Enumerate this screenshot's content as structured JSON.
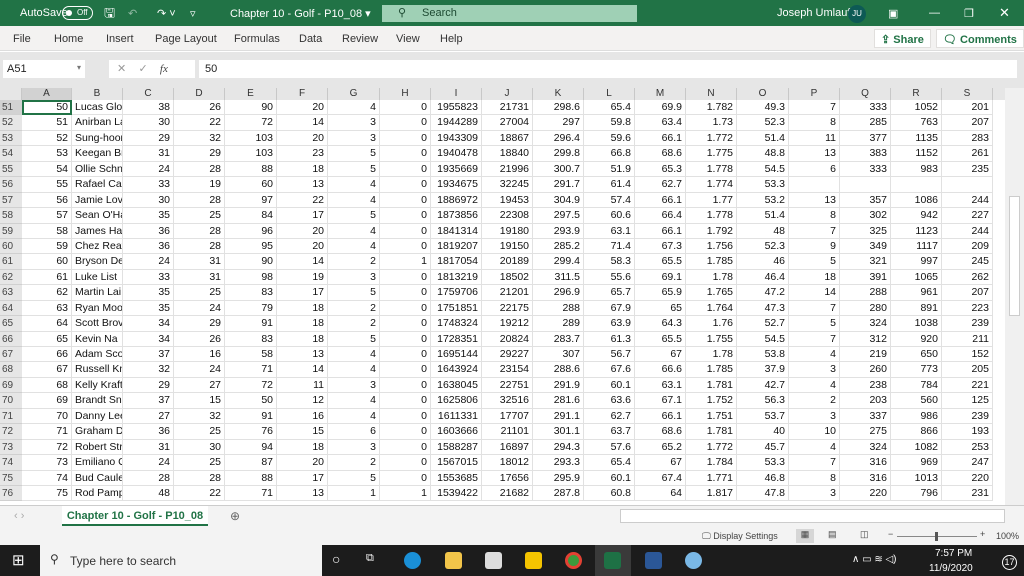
{
  "titlebar": {
    "autosave": "AutoSave",
    "autosave_state": "Off",
    "doc_title": "Chapter 10 - Golf - P10_08 ▾",
    "search": "Search",
    "user": "Joseph Umlauf",
    "initials": "JU"
  },
  "menu": [
    "File",
    "Home",
    "Insert",
    "Page Layout",
    "Formulas",
    "Data",
    "Review",
    "View",
    "Help"
  ],
  "share": "Share",
  "comments": "Comments",
  "formula_bar": {
    "name_box": "A51",
    "fx": "fx",
    "value": "50"
  },
  "columns": [
    "A",
    "B",
    "C",
    "D",
    "E",
    "F",
    "G",
    "H",
    "I",
    "J",
    "K",
    "L",
    "M",
    "N",
    "O",
    "P",
    "Q",
    "R",
    "S"
  ],
  "rows": [
    {
      "n": "51",
      "c": [
        "50",
        "Lucas Glov",
        "38",
        "26",
        "90",
        "20",
        "4",
        "0",
        "1955823",
        "21731",
        "298.6",
        "65.4",
        "69.9",
        "1.782",
        "49.3",
        "7",
        "333",
        "1052",
        "201"
      ]
    },
    {
      "n": "52",
      "c": [
        "51",
        "Anirban La",
        "30",
        "22",
        "72",
        "14",
        "3",
        "0",
        "1944289",
        "27004",
        "297",
        "59.8",
        "63.4",
        "1.73",
        "52.3",
        "8",
        "285",
        "763",
        "207"
      ]
    },
    {
      "n": "53",
      "c": [
        "52",
        "Sung-hoon",
        "29",
        "32",
        "103",
        "20",
        "3",
        "0",
        "1943309",
        "18867",
        "296.4",
        "59.6",
        "66.1",
        "1.772",
        "51.4",
        "11",
        "377",
        "1135",
        "283"
      ]
    },
    {
      "n": "54",
      "c": [
        "53",
        "Keegan Br",
        "31",
        "29",
        "103",
        "23",
        "5",
        "0",
        "1940478",
        "18840",
        "299.8",
        "66.8",
        "68.6",
        "1.775",
        "48.8",
        "13",
        "383",
        "1152",
        "261"
      ]
    },
    {
      "n": "55",
      "c": [
        "54",
        "Ollie Schni",
        "24",
        "28",
        "88",
        "18",
        "5",
        "0",
        "1935669",
        "21996",
        "300.7",
        "51.9",
        "65.3",
        "1.778",
        "54.5",
        "6",
        "333",
        "983",
        "235"
      ]
    },
    {
      "n": "56",
      "c": [
        "55",
        "Rafael Cab",
        "33",
        "19",
        "60",
        "13",
        "4",
        "0",
        "1934675",
        "32245",
        "291.7",
        "61.4",
        "62.7",
        "1.774",
        "53.3",
        "",
        "",
        "",
        ""
      ]
    },
    {
      "n": "57",
      "c": [
        "56",
        "Jamie Love",
        "30",
        "28",
        "97",
        "22",
        "4",
        "0",
        "1886972",
        "19453",
        "304.9",
        "57.4",
        "66.1",
        "1.77",
        "53.2",
        "13",
        "357",
        "1086",
        "244"
      ]
    },
    {
      "n": "58",
      "c": [
        "57",
        "Sean O'Ha",
        "35",
        "25",
        "84",
        "17",
        "5",
        "0",
        "1873856",
        "22308",
        "297.5",
        "60.6",
        "66.4",
        "1.778",
        "51.4",
        "8",
        "302",
        "942",
        "227"
      ]
    },
    {
      "n": "59",
      "c": [
        "58",
        "James Hah",
        "36",
        "28",
        "96",
        "20",
        "4",
        "0",
        "1841314",
        "19180",
        "293.9",
        "63.1",
        "66.1",
        "1.792",
        "48",
        "7",
        "325",
        "1123",
        "244"
      ]
    },
    {
      "n": "60",
      "c": [
        "59",
        "Chez Reav",
        "36",
        "28",
        "95",
        "20",
        "4",
        "0",
        "1819207",
        "19150",
        "285.2",
        "71.4",
        "67.3",
        "1.756",
        "52.3",
        "9",
        "349",
        "1117",
        "209"
      ]
    },
    {
      "n": "61",
      "c": [
        "60",
        "Bryson De",
        "24",
        "31",
        "90",
        "14",
        "2",
        "1",
        "1817054",
        "20189",
        "299.4",
        "58.3",
        "65.5",
        "1.785",
        "46",
        "5",
        "321",
        "997",
        "245"
      ]
    },
    {
      "n": "62",
      "c": [
        "61",
        "Luke List",
        "33",
        "31",
        "98",
        "19",
        "3",
        "0",
        "1813219",
        "18502",
        "311.5",
        "55.6",
        "69.1",
        "1.78",
        "46.4",
        "18",
        "391",
        "1065",
        "262"
      ]
    },
    {
      "n": "63",
      "c": [
        "62",
        "Martin Lai",
        "35",
        "25",
        "83",
        "17",
        "5",
        "0",
        "1759706",
        "21201",
        "296.9",
        "65.7",
        "65.9",
        "1.765",
        "47.2",
        "14",
        "288",
        "961",
        "207"
      ]
    },
    {
      "n": "64",
      "c": [
        "63",
        "Ryan Moo",
        "35",
        "24",
        "79",
        "18",
        "2",
        "0",
        "1751851",
        "22175",
        "288",
        "67.9",
        "65",
        "1.764",
        "47.3",
        "7",
        "280",
        "891",
        "223"
      ]
    },
    {
      "n": "65",
      "c": [
        "64",
        "Scott Brov",
        "34",
        "29",
        "91",
        "18",
        "2",
        "0",
        "1748324",
        "19212",
        "289",
        "63.9",
        "64.3",
        "1.76",
        "52.7",
        "5",
        "324",
        "1038",
        "239"
      ]
    },
    {
      "n": "66",
      "c": [
        "65",
        "Kevin Na",
        "34",
        "26",
        "83",
        "18",
        "5",
        "0",
        "1728351",
        "20824",
        "283.7",
        "61.3",
        "65.5",
        "1.755",
        "54.5",
        "7",
        "312",
        "920",
        "211"
      ]
    },
    {
      "n": "67",
      "c": [
        "66",
        "Adam Sco",
        "37",
        "16",
        "58",
        "13",
        "4",
        "0",
        "1695144",
        "29227",
        "307",
        "56.7",
        "67",
        "1.78",
        "53.8",
        "4",
        "219",
        "650",
        "152"
      ]
    },
    {
      "n": "68",
      "c": [
        "67",
        "Russell Kn",
        "32",
        "24",
        "71",
        "14",
        "4",
        "0",
        "1643924",
        "23154",
        "288.6",
        "67.6",
        "66.6",
        "1.785",
        "37.9",
        "3",
        "260",
        "773",
        "205"
      ]
    },
    {
      "n": "69",
      "c": [
        "68",
        "Kelly Kraft",
        "29",
        "27",
        "72",
        "11",
        "3",
        "0",
        "1638045",
        "22751",
        "291.9",
        "60.1",
        "63.1",
        "1.781",
        "42.7",
        "4",
        "238",
        "784",
        "221"
      ]
    },
    {
      "n": "70",
      "c": [
        "69",
        "Brandt Sn",
        "37",
        "15",
        "50",
        "12",
        "4",
        "0",
        "1625806",
        "32516",
        "281.6",
        "63.6",
        "67.1",
        "1.752",
        "56.3",
        "2",
        "203",
        "560",
        "125"
      ]
    },
    {
      "n": "71",
      "c": [
        "70",
        "Danny Lee",
        "27",
        "32",
        "91",
        "16",
        "4",
        "0",
        "1611331",
        "17707",
        "291.1",
        "62.7",
        "66.1",
        "1.751",
        "53.7",
        "3",
        "337",
        "986",
        "239"
      ]
    },
    {
      "n": "72",
      "c": [
        "71",
        "Graham D",
        "36",
        "25",
        "76",
        "15",
        "6",
        "0",
        "1603666",
        "21101",
        "301.1",
        "63.7",
        "68.6",
        "1.781",
        "40",
        "10",
        "275",
        "866",
        "193"
      ]
    },
    {
      "n": "73",
      "c": [
        "72",
        "Robert Str",
        "31",
        "30",
        "94",
        "18",
        "3",
        "0",
        "1588287",
        "16897",
        "294.3",
        "57.6",
        "65.2",
        "1.772",
        "45.7",
        "4",
        "324",
        "1082",
        "253"
      ]
    },
    {
      "n": "74",
      "c": [
        "73",
        "Emiliano G",
        "24",
        "25",
        "87",
        "20",
        "2",
        "0",
        "1567015",
        "18012",
        "293.3",
        "65.4",
        "67",
        "1.784",
        "53.3",
        "7",
        "316",
        "969",
        "247"
      ]
    },
    {
      "n": "75",
      "c": [
        "74",
        "Bud Caule",
        "28",
        "28",
        "88",
        "17",
        "5",
        "0",
        "1553685",
        "17656",
        "295.9",
        "60.1",
        "67.4",
        "1.771",
        "46.8",
        "8",
        "316",
        "1013",
        "220"
      ]
    },
    {
      "n": "76",
      "c": [
        "75",
        "Rod Pamp",
        "48",
        "22",
        "71",
        "13",
        "1",
        "1",
        "1539422",
        "21682",
        "287.8",
        "60.8",
        "64",
        "1.817",
        "47.8",
        "3",
        "220",
        "796",
        "231"
      ]
    }
  ],
  "sheet_tab": "Chapter 10 - Golf - P10_08",
  "status": {
    "display_settings": "Display Settings",
    "zoom": "100%",
    "zoom_level": 100
  },
  "taskbar": {
    "search": "Type here to search",
    "time": "7:57 PM",
    "date": "11/9/2020",
    "notifications": "17"
  },
  "colors": {
    "excel_green": "#217346",
    "taskbar": "#1c1c1c"
  }
}
